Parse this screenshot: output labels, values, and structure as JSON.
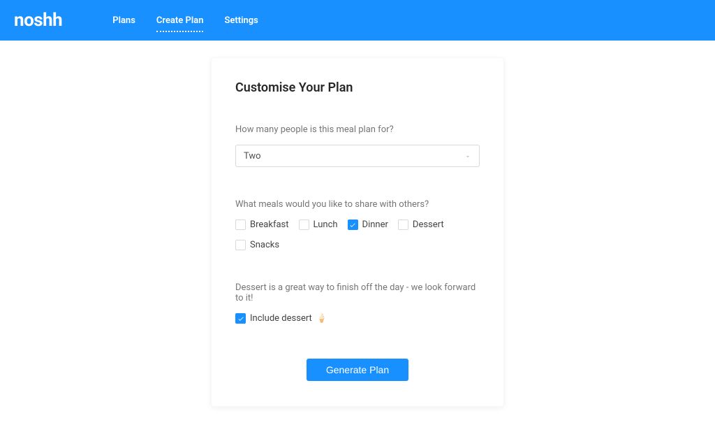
{
  "brand": "noshh",
  "nav": {
    "plans": "Plans",
    "create_plan": "Create Plan",
    "settings": "Settings"
  },
  "card": {
    "title": "Customise Your Plan",
    "people_label": "How many people is this meal plan for?",
    "people_value": "Two",
    "meals_label": "What meals would you like to share with others?",
    "meals": {
      "breakfast": {
        "label": "Breakfast",
        "checked": false
      },
      "lunch": {
        "label": "Lunch",
        "checked": false
      },
      "dinner": {
        "label": "Dinner",
        "checked": true
      },
      "dessert": {
        "label": "Dessert",
        "checked": false
      },
      "snacks": {
        "label": "Snacks",
        "checked": false
      }
    },
    "dessert_label": "Dessert is a great way to finish off the day - we look forward to it!",
    "include_dessert": {
      "label": "Include dessert",
      "checked": true
    },
    "generate_label": "Generate Plan"
  }
}
